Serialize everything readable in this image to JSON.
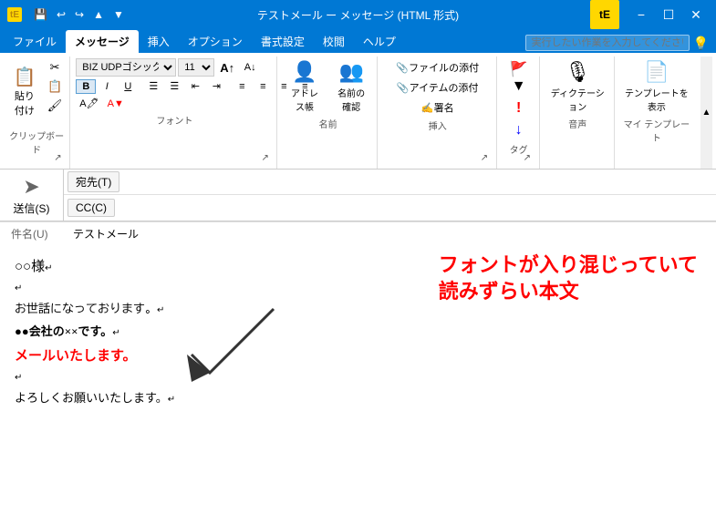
{
  "titleBar": {
    "icon": "✉",
    "title": "テストメール ー メッセージ (HTML 形式)",
    "quickAccess": [
      "💾",
      "↩",
      "↪",
      "↑",
      "↓"
    ],
    "controls": [
      "🗕",
      "🗗",
      "✕"
    ],
    "appIcon": "tE"
  },
  "ribbon": {
    "tabs": [
      {
        "label": "ファイル",
        "active": false
      },
      {
        "label": "メッセージ",
        "active": true
      },
      {
        "label": "挿入",
        "active": false
      },
      {
        "label": "オプション",
        "active": false
      },
      {
        "label": "書式設定",
        "active": false
      },
      {
        "label": "校閲",
        "active": false
      },
      {
        "label": "ヘルプ",
        "active": false
      }
    ],
    "searchPlaceholder": "実行したい作業を入力してください",
    "groups": {
      "clipboard": {
        "label": "クリップボード",
        "paste": "貼り付け",
        "cut": "✂",
        "copy": "📋",
        "format": "🖌"
      },
      "font": {
        "label": "フォント",
        "fontName": "BIZ UDPゴシック",
        "fontSize": "11",
        "bold": "B",
        "italic": "I",
        "underline": "U",
        "listBullet": "≡",
        "listNumber": "≡",
        "indent": "⇥",
        "outdent": "⇤",
        "alignLeft": "≡",
        "alignCenter": "≡",
        "alignRight": "≡",
        "justify": "≡",
        "decreaseFont": "A",
        "increaseFont": "A"
      },
      "names": {
        "label": "名前",
        "addressBook": "アドレス帳",
        "checkNames": "名前の確認"
      },
      "insert": {
        "label": "挿入",
        "attach": "ファイルの添付",
        "attachItem": "アイテムの添付",
        "signature": "署名"
      },
      "tags": {
        "label": "タグ",
        "flag": "🚩",
        "importance": "!"
      },
      "voice": {
        "label": "音声",
        "dictate": "ディクテーション"
      },
      "templates": {
        "label": "マイ テンプレート",
        "show": "テンプレートを表示"
      }
    }
  },
  "compose": {
    "toLabel": "宛先(T)",
    "ccLabel": "CC(C)",
    "subjectLabel": "件名(U)",
    "subjectValue": "テストメール",
    "sendLabel": "送信(S)",
    "toValue": "",
    "ccValue": ""
  },
  "body": {
    "line1": "○○様↵",
    "line2": "",
    "line3": "お世話になっております。↵",
    "line4": "●●会社の××です。↵",
    "line5": "メールいたします。",
    "line6": "",
    "line7": "よろしくお願いいたします。↵"
  },
  "annotation": {
    "text": "フォントが入り混じっていて\n読みずらい本文"
  }
}
